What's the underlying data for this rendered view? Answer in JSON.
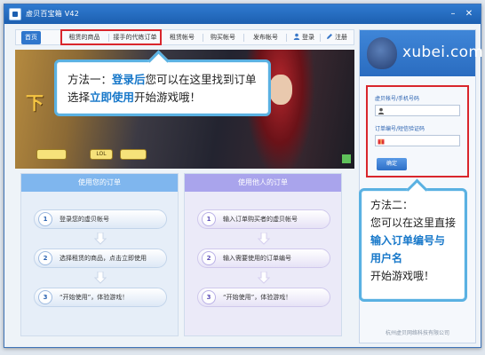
{
  "window": {
    "title": "虚贝百宝箱 V42",
    "minimize_icon": "minimize-icon",
    "close_icon": "close-icon"
  },
  "tabs": [
    {
      "label": "首页",
      "active": true
    },
    {
      "label": "租赁的商品"
    },
    {
      "label": "接手的代练订单"
    },
    {
      "label": "租赁帐号"
    },
    {
      "label": "购买帐号"
    },
    {
      "label": "发布帐号"
    },
    {
      "label": "登录",
      "icon": "user-icon"
    },
    {
      "label": "注册",
      "icon": "edit-icon"
    }
  ],
  "banner": {
    "headline": "下",
    "badges": [
      "",
      "LOL",
      ""
    ]
  },
  "callout1": {
    "prefix": "方法一：",
    "strong1": "登录后",
    "mid": "您可以在这里找到订单",
    "line2_a": "选择",
    "strong2": "立即使用",
    "line2_b": "开始游戏哦！"
  },
  "panel_left": {
    "title": "使用您的订单",
    "steps": [
      {
        "num": "1",
        "text": "登录您的虚贝帐号"
      },
      {
        "num": "2",
        "text": "选择租赁的商品，点击立即使用"
      },
      {
        "num": "3",
        "text": "“开始使用”，体验游戏！"
      }
    ]
  },
  "panel_right": {
    "title": "使用他人的订单",
    "steps": [
      {
        "num": "1",
        "text": "输入订单购买者的虚贝帐号"
      },
      {
        "num": "2",
        "text": "输入需要使用的订单编号"
      },
      {
        "num": "3",
        "text": "“开始使用”，体验游戏！"
      }
    ]
  },
  "sidebar": {
    "logo_text": "xubei.com",
    "account_label": "虚贝帐号/手机号码",
    "account_value": "",
    "order_label": "订单编号/短信验证码",
    "order_value": "",
    "confirm_label": "确定",
    "footer": "杭州虚贝网络科技有限公司"
  },
  "callout2": {
    "line1": "方法二：",
    "line2": "您可以在这里直接",
    "strong1": "输入订单编号与",
    "strong2": "用户名",
    "line3": "开始游戏哦！"
  },
  "colors": {
    "accent": "#2f76cc",
    "highlight_border": "#d9262c",
    "callout_border": "#5ab1e2",
    "panel_left_head": "#7fb6ee",
    "panel_right_head": "#a9a4ec"
  }
}
